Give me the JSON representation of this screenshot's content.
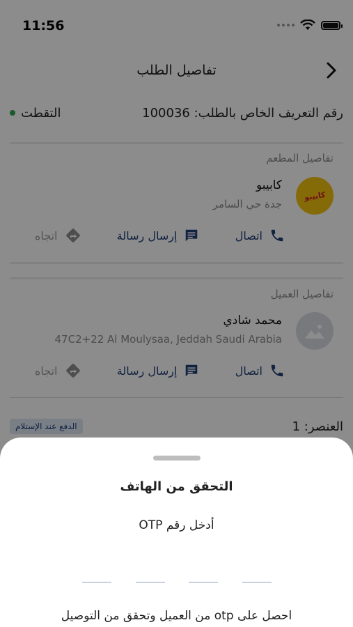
{
  "status": {
    "time": "11:56"
  },
  "header": {
    "title": "تفاصيل الطلب"
  },
  "order": {
    "id_label": "رقم التعريف الخاص بالطلب: 100036",
    "status": "التقطت"
  },
  "restaurant": {
    "section_label": "تفاصيل المطعم",
    "name": "كابيبو",
    "address": "جدة حي السامر",
    "logo_text": "كابيبو"
  },
  "customer": {
    "section_label": "تفاصيل العميل",
    "name": "محمد شادي",
    "address": "47C2+22 Al Moulysaa, Jeddah Saudi Arabia"
  },
  "actions": {
    "call": "اتصال",
    "message": "إرسال رسالة",
    "directions": "اتجاه"
  },
  "items": {
    "count_label": "العنصر: 1",
    "payment_badge": "الدفع عند الإستلام"
  },
  "otp_sheet": {
    "title": "التحقق من الهاتف",
    "prompt": "أدخل رقم OTP",
    "hint": "احصل على otp من العميل وتحقق من التوصيل",
    "digits": [
      "",
      "",
      "",
      ""
    ]
  },
  "colors": {
    "accent": "#1f3c76",
    "status_green": "#2aa64a",
    "logo_bg": "#f3c20f"
  }
}
